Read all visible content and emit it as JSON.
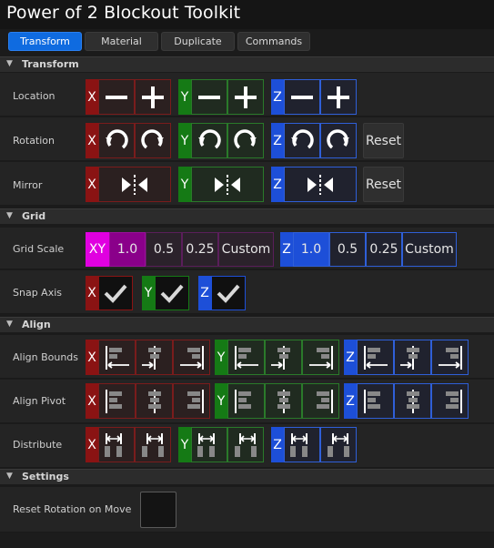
{
  "window": {
    "title": "Power of 2 Blockout Toolkit"
  },
  "tabs": [
    {
      "label": "Transform",
      "active": true
    },
    {
      "label": "Material"
    },
    {
      "label": "Duplicate"
    },
    {
      "label": "Commands"
    }
  ],
  "sections": {
    "transform": "Transform",
    "grid": "Grid",
    "align": "Align",
    "settings": "Settings"
  },
  "transform": {
    "location_label": "Location",
    "rotation_label": "Rotation",
    "mirror_label": "Mirror",
    "reset_label": "Reset"
  },
  "axes": {
    "x": "X",
    "y": "Y",
    "z": "Z",
    "xy": "XY"
  },
  "grid": {
    "scale_label": "Grid Scale",
    "snap_label": "Snap Axis",
    "xy_values": [
      "1.0",
      "0.5",
      "0.25",
      "Custom"
    ],
    "xy_selected": "1.0",
    "z_values": [
      "1.0",
      "0.5",
      "0.25",
      "Custom"
    ],
    "z_selected": "1.0",
    "snap": {
      "x": true,
      "y": true,
      "z": true
    }
  },
  "align": {
    "bounds_label": "Align Bounds",
    "pivot_label": "Align Pivot",
    "distribute_label": "Distribute"
  },
  "settings": {
    "reset_rotation_label": "Reset Rotation on Move",
    "reset_rotation_checked": false
  },
  "colors": {
    "accent": "#0f6be0",
    "axis_x": "#8a1313",
    "axis_y": "#157a15",
    "axis_z": "#1d4fd8",
    "xy_magenta": "#e000e0"
  }
}
